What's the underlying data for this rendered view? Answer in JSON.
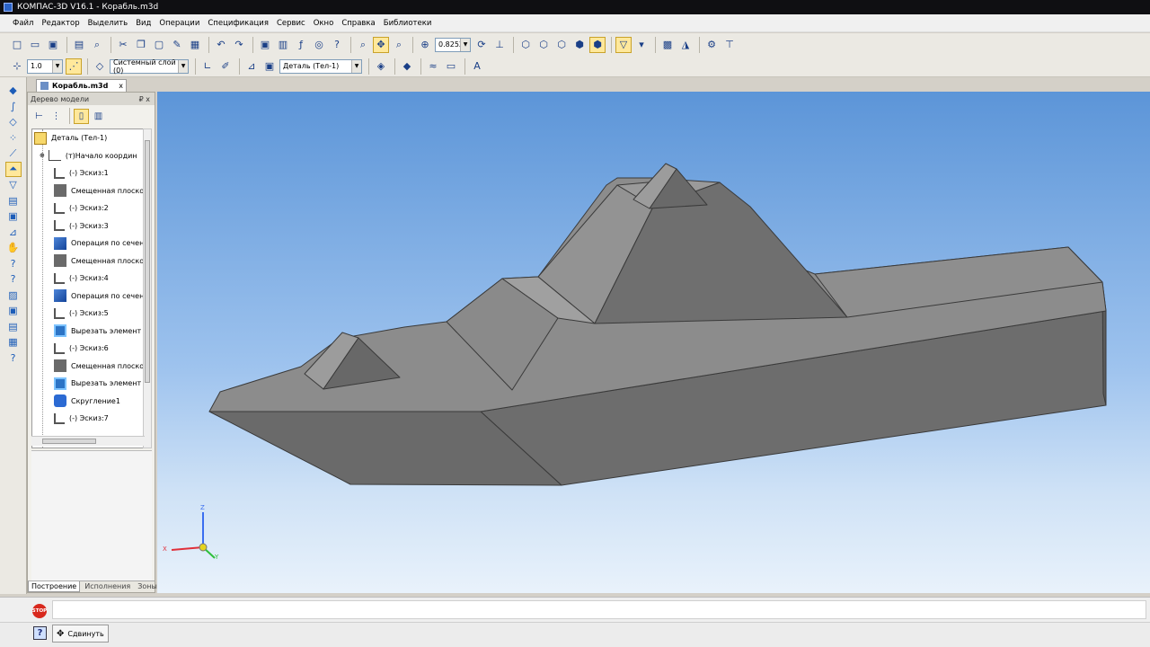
{
  "window": {
    "title": "КОМПАС-3D V16.1 - Корабль.m3d"
  },
  "menu": [
    "Файл",
    "Редактор",
    "Выделить",
    "Вид",
    "Операции",
    "Спецификация",
    "Сервис",
    "Окно",
    "Справка",
    "Библиотеки"
  ],
  "toolbar": {
    "zoom_value": "0.8252",
    "step_value": "1.0",
    "layer_value": "Системный слой (0)",
    "part_value": "Деталь (Тел-1)"
  },
  "document_tab": {
    "label": "Корабль.m3d",
    "close": "x"
  },
  "tree_panel": {
    "title": "Дерево модели",
    "pin": "₽ x",
    "items": [
      {
        "label": "Деталь (Тел-1)",
        "icon": "part-icon"
      },
      {
        "label": "(т)Начало координ",
        "icon": "origin-icon"
      },
      {
        "label": "(-) Эскиз:1",
        "icon": "sketch-icon"
      },
      {
        "label": "Смещенная плоскос",
        "icon": "plane-icon"
      },
      {
        "label": "(-) Эскиз:2",
        "icon": "sketch-icon"
      },
      {
        "label": "(-) Эскиз:3",
        "icon": "sketch-icon"
      },
      {
        "label": "Операция по сечен",
        "icon": "loft-icon"
      },
      {
        "label": "Смещенная плоскос",
        "icon": "plane-icon"
      },
      {
        "label": "(-) Эскиз:4",
        "icon": "sketch-icon"
      },
      {
        "label": "Операция по сечен",
        "icon": "loft-icon"
      },
      {
        "label": "(-) Эскиз:5",
        "icon": "sketch-icon"
      },
      {
        "label": "Вырезать элемент",
        "icon": "cut-icon"
      },
      {
        "label": "(-) Эскиз:6",
        "icon": "sketch-icon"
      },
      {
        "label": "Смещенная плоскос",
        "icon": "plane-icon"
      },
      {
        "label": "Вырезать элемент",
        "icon": "cut-icon"
      },
      {
        "label": "Скругление1",
        "icon": "fillet-icon"
      },
      {
        "label": "(-) Эскиз:7",
        "icon": "sketch-icon"
      }
    ],
    "tabs": [
      "Построение",
      "Исполнения",
      "Зоны"
    ]
  },
  "viewport": {
    "axis_labels": {
      "x": "X",
      "y": "Y",
      "z": "Z"
    }
  },
  "bottom": {
    "stop_label": "STOP",
    "help_label": "?",
    "move_label": "Сдвинуть"
  },
  "colors": {
    "accent": "#ffe89b",
    "viewport_top": "#5c95d8",
    "viewport_bottom": "#e9f2fb",
    "model_gray": "#7a7a7a"
  }
}
